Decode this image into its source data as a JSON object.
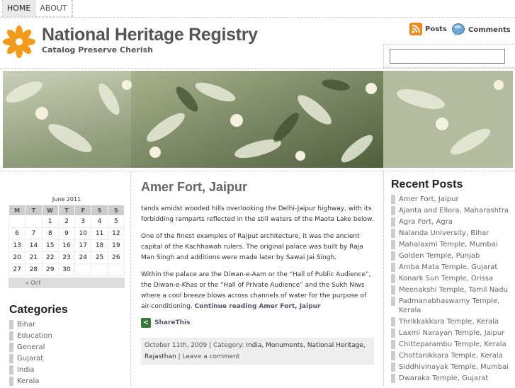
{
  "nav": {
    "items": [
      "HOME",
      "ABOUT"
    ]
  },
  "site": {
    "title": "National Heritage Registry",
    "tagline": "Catalog Preserve Cherish"
  },
  "feeds": {
    "posts": "Posts",
    "comments": "Comments"
  },
  "calendar": {
    "caption": "June 2011",
    "days": [
      "M",
      "T",
      "W",
      "T",
      "F",
      "S",
      "S"
    ],
    "weeks": [
      [
        "",
        "",
        "1",
        "2",
        "3",
        "4",
        "5"
      ],
      [
        "6",
        "7",
        "8",
        "9",
        "10",
        "11",
        "12"
      ],
      [
        "13",
        "14",
        "15",
        "16",
        "17",
        "18",
        "19"
      ],
      [
        "20",
        "21",
        "22",
        "23",
        "24",
        "25",
        "26"
      ],
      [
        "27",
        "28",
        "29",
        "30",
        "",
        "",
        ""
      ]
    ],
    "prev": "« Oct"
  },
  "categories": {
    "title": "Categories",
    "items": [
      "Bihar",
      "Education",
      "General",
      "Gujarat",
      "India",
      "Kerala"
    ]
  },
  "post": {
    "title": "Amer Fort, Jaipur",
    "p1": "tands amidst wooded hills overlooking the Delhi-Jaipur highway, with its forbidding ramparts reflected in the still waters of the Maota Lake below.",
    "p2": "One of the finest examples of Rajput architecture, it was the ancient capital of the Kachhawah rulers. The original palace was built by Raja Man Singh and additions were made later by Sawai Jai Singh.",
    "p3": "Within the palace are the Diwan-e-Aam or the “Hall of Public Audience”, the Diwan-e-Khas or the “Hall of Private Audience” and the Sukh Niws where a cool breeze blows across channels of water for the purpose of air-conditioning.",
    "more": "Continue reading Amer Fort, Jaipur",
    "share": "ShareThis",
    "meta_date": "October 11th, 2009 | Category: ",
    "meta_cats": "India, Monuments, National Heritage, Rajasthan",
    "meta_sep": " | ",
    "meta_comment": "Leave a comment"
  },
  "recent": {
    "title": "Recent Posts",
    "items": [
      "Amer Fort, Jaipur",
      "Ajanta and Ellora, Maharashtra",
      "Agra Fort, Agra",
      "Nalanda University, Bihar",
      "Mahalaxmi Temple, Mumbai",
      "Golden Temple, Punjab",
      "Amba Mata Temple, Gujarat",
      "Konark Sun Temple, Orissa",
      "Meenakshi Temple, Tamil Nadu",
      "Padmanabhaswamy Temple, Kerala",
      "Thrikkakkara Temple, Kerala",
      "Laxmi Narayan Temple, Jaipur",
      "Chitteparambu Temple, Kerala",
      "Chottanikkara Temple, Kerala",
      "Siddhivinayak Temple, Mumbai",
      "Dwaraka Temple, Gujarat"
    ]
  }
}
